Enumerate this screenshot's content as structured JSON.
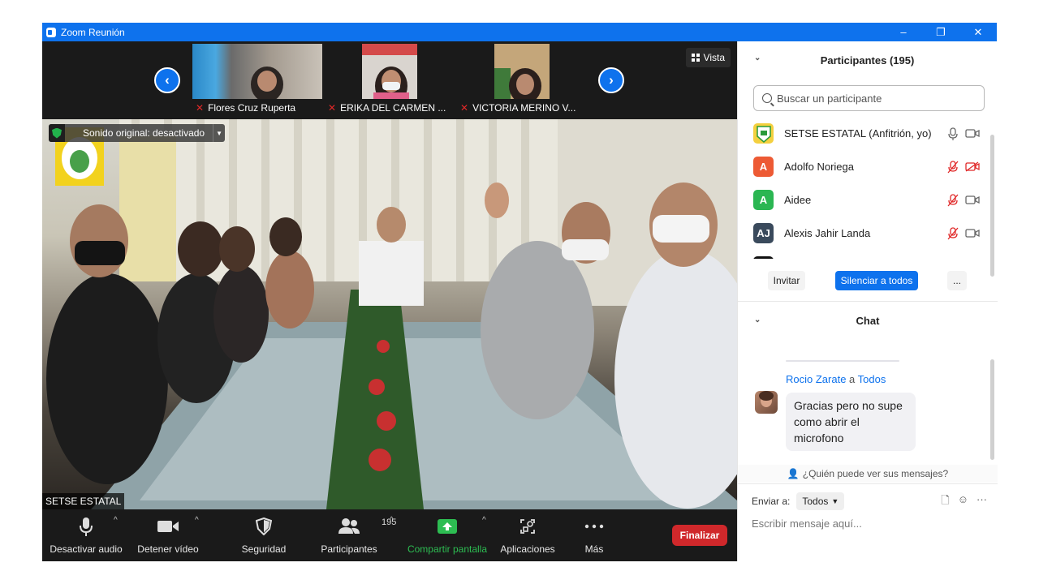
{
  "window": {
    "title": "Zoom Reunión",
    "controls": [
      "–",
      "❐",
      "✕"
    ]
  },
  "thumbnails": [
    {
      "name": "Flores Cruz Ruperta"
    },
    {
      "name": "ERIKA DEL CARMEN ..."
    },
    {
      "name": "VICTORIA MERINO V..."
    }
  ],
  "view_button": {
    "label": "Vista"
  },
  "main_video": {
    "sound_banner": "Sonido original: desactivado",
    "speaker_name": "SETSE ESTATAL"
  },
  "toolbar": {
    "mute": "Desactivar audio",
    "video": "Detener vídeo",
    "security": "Seguridad",
    "participants": "Participantes",
    "participants_count": "195",
    "share": "Compartir pantalla",
    "apps": "Aplicaciones",
    "more": "Más",
    "end": "Finalizar"
  },
  "participants_panel": {
    "title": "Participantes (195)",
    "search_placeholder": "Buscar un participante",
    "items": [
      {
        "name": "SETSE ESTATAL (Anfitrión, yo)",
        "avatar_text": "",
        "avatar_color": "#f4d03f",
        "mic": "on",
        "cam": "on"
      },
      {
        "name": "Adolfo Noriega",
        "avatar_text": "A",
        "avatar_color": "#ed5a34",
        "mic": "muted",
        "cam": "off"
      },
      {
        "name": "Aidee",
        "avatar_text": "A",
        "avatar_color": "#2bb652",
        "mic": "muted",
        "cam": "on"
      },
      {
        "name": "Alexis Jahir Landa",
        "avatar_text": "AJ",
        "avatar_color": "#3a4a5c",
        "mic": "muted",
        "cam": "on"
      }
    ],
    "buttons": {
      "invite": "Invitar",
      "mute_all": "Silenciar a todos",
      "more": "..."
    }
  },
  "chat_panel": {
    "title": "Chat",
    "message": {
      "sender": "Rocio Zarate",
      "to_prefix": "a",
      "to": "Todos",
      "text_lines": [
        "Gracias pero no supe",
        "como abrir el",
        "microfono"
      ]
    },
    "who_sees": "¿Quién puede ver sus mensajes?",
    "send_to_label": "Enviar a:",
    "send_to_value": "Todos",
    "compose_placeholder": "Escribir mensaje aquí..."
  },
  "colors": {
    "zoom_blue": "#0e72ed",
    "end_red": "#d0282b",
    "share_green": "#2dbd52",
    "muted_red": "#e02828"
  }
}
